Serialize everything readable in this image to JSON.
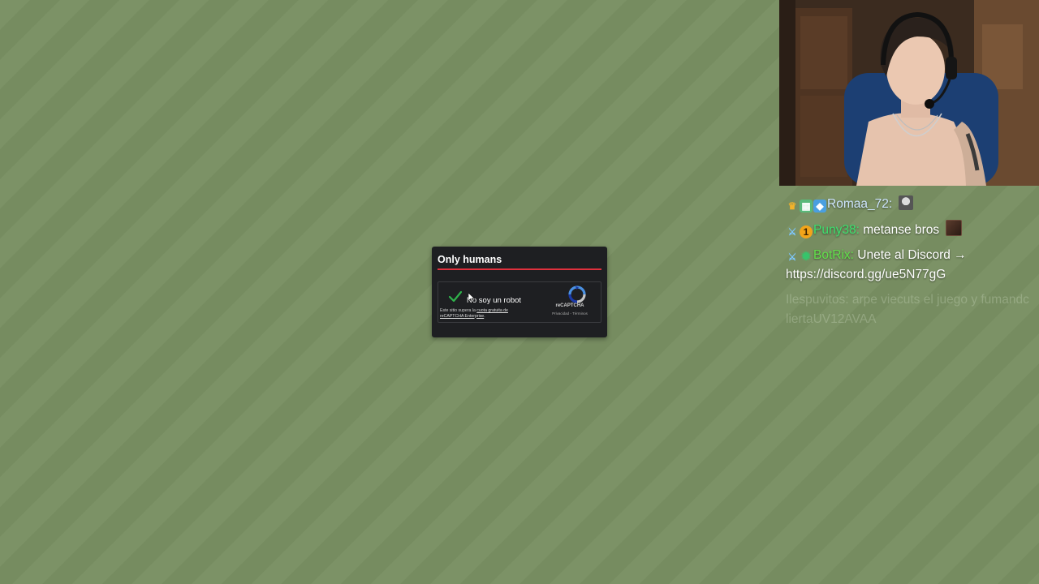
{
  "captcha": {
    "title": "Only humans",
    "checkbox_label": "No soy un robot",
    "note_prefix": "Este sitio supera la",
    "note_link": "cuota gratuita de reCAPTCHA Enterprise",
    "note_suffix": ".",
    "brand": "reCAPTCHA",
    "privacy": "Privacidad",
    "separator": " - ",
    "terms": "Términos",
    "checked": true
  },
  "chat": {
    "messages": [
      {
        "badges": [
          "crown-icon",
          "gift-icon",
          "box-icon"
        ],
        "user": "Romaa_72",
        "separator": ":",
        "text": "",
        "emote": "cat-emote"
      },
      {
        "badges": [
          "sword-icon",
          "coin-icon"
        ],
        "user": "Puny38",
        "separator": ":",
        "text": "metanse bros",
        "emote": "face-emote"
      },
      {
        "badges": [
          "sword-icon",
          "gear-icon"
        ],
        "user": "BotRix",
        "separator": ":",
        "text": "Unete al Discord → https://discord.gg/ue5N77gG"
      }
    ],
    "faded_text": "Ilespuvitos: arpe viecuts el juego y fumandc liertaUV12AVAA"
  },
  "colors": {
    "background": "#7a9064",
    "captcha_accent": "#e0303d",
    "check_green": "#2fb34b",
    "user_romaa": "#cfe6ff",
    "user_puny": "#3ee06f",
    "user_botrix": "#61e04a"
  }
}
